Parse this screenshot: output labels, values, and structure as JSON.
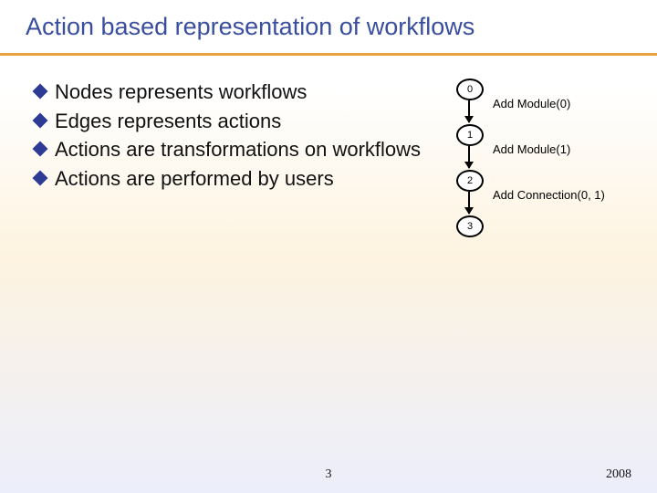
{
  "title": "Action based representation of workflows",
  "bullets": [
    "Nodes represents workflows",
    "Edges represents actions",
    "Actions are transformations on workflows",
    "Actions are performed by users"
  ],
  "diagram": {
    "nodes": [
      "0",
      "1",
      "2",
      "3"
    ],
    "edge_labels": [
      "Add Module(0)",
      "Add Module(1)",
      "Add Connection(0, 1)"
    ]
  },
  "page_number": "3",
  "year": "2008"
}
